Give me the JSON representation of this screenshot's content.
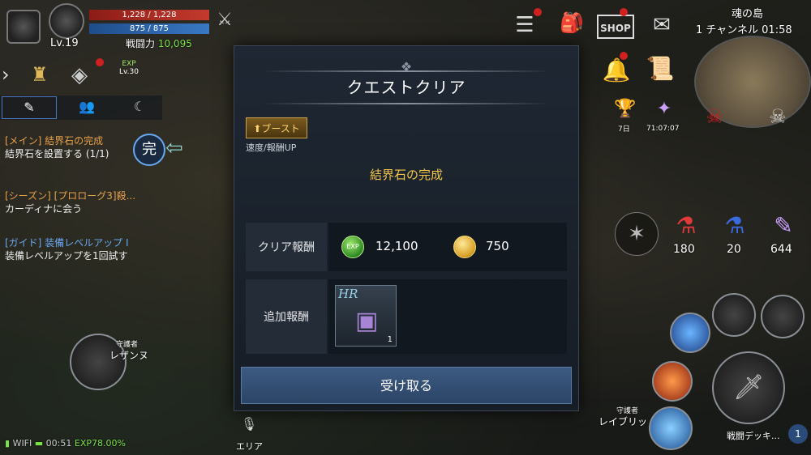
{
  "player": {
    "level": "Lv.19",
    "hp": "1,228 / 1,228",
    "mp": "875 / 875",
    "combat_power_label": "戦闘力",
    "combat_power": "10,095",
    "hp_fraction": 1.0,
    "mp_fraction": 1.0
  },
  "top_right": {
    "zone": "魂の島",
    "channel": "1 チャンネル",
    "time": "01:58",
    "shop_label": "SHOP",
    "timer": "71:07:07",
    "day_badge": "7日"
  },
  "left_panel": {
    "exp_badge": "EXP",
    "exp_level": "Lv.30",
    "complete_badge": "完",
    "quests": [
      {
        "title": "[メイン] 結界石の完成",
        "desc": "結界石を設置する (1/1)"
      },
      {
        "title": "[シーズン] [プロローグ3]殺...",
        "desc": "カーディナに会う"
      },
      {
        "title": "[ガイド] 装備レベルアップ I",
        "desc": "装備レベルアップを1回試す"
      }
    ]
  },
  "modal": {
    "title": "クエストクリア",
    "boost_label": "ブースト",
    "boost_sub": "速度/報酬UP",
    "quest_name": "結界石の完成",
    "clear_reward_label": "クリア報酬",
    "exp_icon_label": "EXP",
    "exp_amount": "12,100",
    "gold_amount": "750",
    "extra_reward_label": "追加報酬",
    "item_grade": "HR",
    "item_count": "1",
    "confirm_label": "受け取る"
  },
  "potions": [
    "180",
    "20",
    "644"
  ],
  "guardians": {
    "left_caption": "守護者",
    "left_name": "レザンヌ",
    "right_caption": "守護者",
    "right_name": "レイブリッ"
  },
  "bottom": {
    "wifi": "WIFI",
    "clock": "00:51",
    "exp": "EXP78.00%",
    "mic_label": "エリア",
    "battle_deck": "戦闘デッキ...",
    "deck_num": "1"
  },
  "colors": {
    "accent_gold": "#f3c64b",
    "quest_orange": "#e8a04a",
    "quest_blue": "#6aa8f0",
    "button_blue": "#3d5a82",
    "exp_green": "#7ee04a"
  }
}
